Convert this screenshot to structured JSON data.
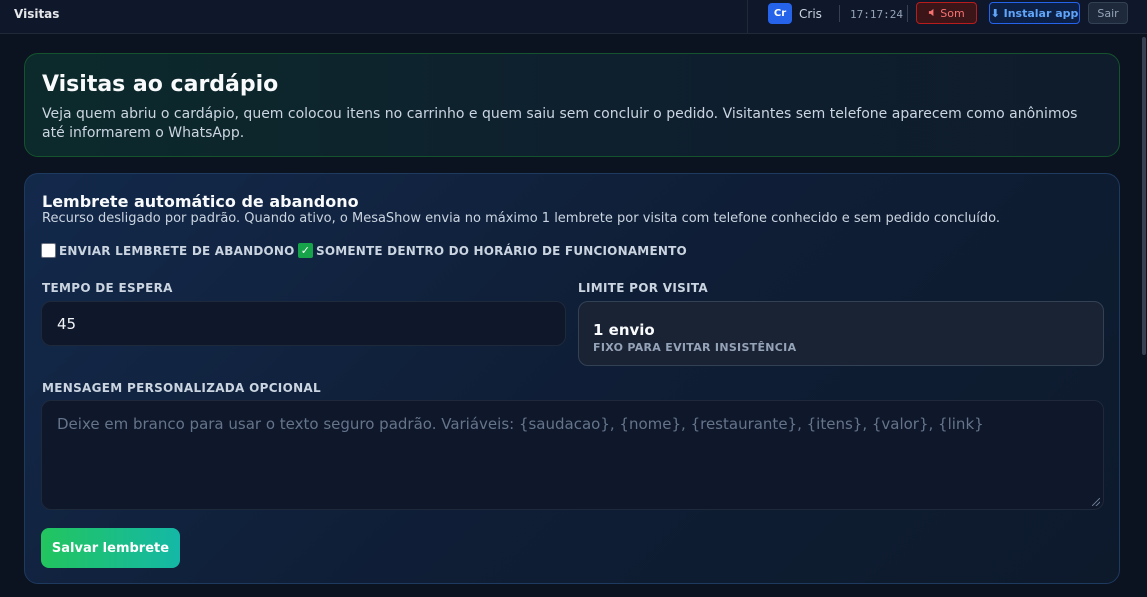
{
  "topbar": {
    "title": "Visitas",
    "user_initials": "Cr",
    "user_name": "Cris",
    "clock": "17:17:24",
    "sound_icon": "speaker-muted-icon",
    "sound_label": "Som",
    "install_icon": "download-arrow-icon",
    "install_label": "⬇ Instalar app",
    "logout_label": "Sair"
  },
  "hero": {
    "title": "Visitas ao cardápio",
    "description": "Veja quem abriu o cardápio, quem colocou itens no carrinho e quem saiu sem concluir o pedido. Visitantes sem telefone aparecem como anônimos até informarem o WhatsApp."
  },
  "reminder": {
    "title": "Lembrete automático de abandono",
    "description": "Recurso desligado por padrão. Quando ativo, o MesaShow envia no máximo 1 lembrete por visita com telefone conhecido e sem pedido concluído.",
    "enable_checkbox": {
      "label": "ENVIAR LEMBRETE DE ABANDONO",
      "checked": false
    },
    "hours_checkbox": {
      "label": "SOMENTE DENTRO DO HORÁRIO DE FUNCIONAMENTO",
      "checked": true
    },
    "wait_label": "TEMPO DE ESPERA",
    "wait_value": "45",
    "limit_label": "LIMITE POR VISITA",
    "limit_value": "1 envio",
    "limit_note": "FIXO PARA EVITAR INSISTÊNCIA",
    "message_label": "MENSAGEM PERSONALIZADA OPCIONAL",
    "message_value": "",
    "message_placeholder": "Deixe em branco para usar o texto seguro padrão. Variáveis: {saudacao}, {nome}, {restaurante}, {itens}, {valor}, {link}",
    "save_label": "Salvar lembrete"
  },
  "colors": {
    "accent_green": "#22c55e",
    "accent_blue": "#2563eb",
    "danger_red": "#b91c1c",
    "background": "#0b1220"
  }
}
